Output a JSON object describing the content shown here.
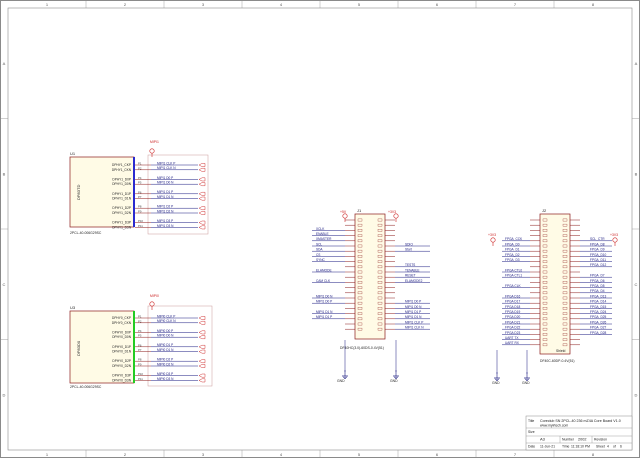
{
  "border": {
    "columns": [
      "1",
      "2",
      "3",
      "4",
      "5",
      "6",
      "7",
      "8"
    ],
    "rows": [
      "A",
      "B",
      "C",
      "D"
    ]
  },
  "u1": {
    "ref": "U1",
    "part": "DP83TD",
    "footprint": "2PCL-40-006G29SC",
    "pins_left": [
      "DPHY1_CKP",
      "DPHY1_CKN",
      "",
      "DPHY1_D0P",
      "DPHY1_D0N",
      "",
      "DPHY1_D1P",
      "DPHY1_D1N",
      "",
      "DPHY1_D2P",
      "DPHY1_D2N",
      "",
      "DPHY1_D3P",
      "DPHY1_D3N"
    ],
    "pin_nums": [
      "P1",
      "P2",
      "",
      "P4",
      "P5",
      "",
      "P6",
      "P7",
      "",
      "P8",
      "P9",
      "",
      "P10",
      "P11"
    ],
    "nets": [
      "MIPI1 CLK P",
      "MIPI1 CLK N",
      "",
      "MIPI1 D0 P",
      "MIPI1 D0 N",
      "",
      "MIPI1 D1 P",
      "MIPI1 D1 N",
      "",
      "MIPI1 D2 P",
      "MIPI1 D2 N",
      "",
      "MIPI1 D3 P",
      "MIPI1 D3 N"
    ],
    "header": "MIPI1",
    "accent": "#2a2ad0"
  },
  "u2": {
    "ref": "U3",
    "part": "DP83D0",
    "footprint": "2PCL-40-006G29SC",
    "pins_left": [
      "DPHY0_CKP",
      "DPHY0_CKN",
      "",
      "DPHY0_D0P",
      "DPHY0_D0N",
      "",
      "DPHY0_D1P",
      "DPHY0_D1N",
      "",
      "DPHY0_D2P",
      "DPHY0_D2N",
      "",
      "DPHY0_D3P",
      "DPHY0_D3N"
    ],
    "pin_nums": [
      "P1",
      "P2",
      "",
      "P4",
      "P5",
      "",
      "P6",
      "P7",
      "",
      "P8",
      "P9",
      "",
      "P10",
      "P11"
    ],
    "nets": [
      "MIPI0 CLK P",
      "MIPI0 CLK N",
      "",
      "MIPI0 D0 P",
      "MIPI0 D0 N",
      "",
      "MIPI0 D1 P",
      "MIPI0 D1 N",
      "",
      "MIPI0 D2 P",
      "MIPI0 D2 N",
      "",
      "MIPI0 D3 P",
      "MIPI0 D3 N"
    ],
    "header": "MIPI0",
    "accent": "#22cc22"
  },
  "j1": {
    "ref": "J1",
    "power_top_left": "+5V",
    "power_top_right": "+3V3",
    "left_nets": [
      "XCLK",
      "ENABLE",
      "XMASTER",
      "SCL",
      "SDA",
      "CS",
      "SYNC",
      "",
      "ELAMODE",
      "",
      "CAM CLK",
      "",
      "",
      "MIPI1 D0 N",
      "MIPI1 D0 P",
      "",
      "MIPI1 D1 N",
      "MIPI1 D1 P"
    ],
    "right_nets": [
      "",
      "SDIO",
      "Start",
      "",
      "",
      "TESTS",
      "TENABLE",
      "RESET",
      "ELAMODE2",
      "",
      "",
      "",
      "MIPI1 D0 P",
      "MIPI1 D0 N",
      "MIPI1 D1 P",
      "MIPI1 D1 N",
      "MIPI1 CLK P",
      "MIPI1 CLK N"
    ],
    "footprint": "DF40HC(3.0)-60DS-0.4V(51)",
    "gnd_left": "GND",
    "gnd_right": "GND"
  },
  "j2": {
    "ref": "J2",
    "power_left": "+3V3",
    "power_right": "+3V3",
    "left_nets": [
      "FPGA_CCK",
      "FPGA_D0",
      "FPGA_D1",
      "FPGA_D2",
      "FPGA_D3",
      "",
      "FPGA CTL0",
      "FPGA CTL1",
      "",
      "FPGA CLK",
      "",
      "FPGA D16",
      "FPGA D17",
      "FPGA D18",
      "FPGA D19",
      "FPGA D20",
      "FPGA D21",
      "FPGA D22",
      "FPGA D23",
      "UART TX",
      "UART RX"
    ],
    "right_nets": [
      "SCL_CTR",
      "FPGA_D8",
      "FPGA_D9",
      "FPGA_D10",
      "FPGA_D11",
      "FPGA_D12",
      "",
      "FPGA_D7",
      "FPGA_D6",
      "FPGA_D5",
      "FPGA_D4",
      "FPGA_D13",
      "FPGA_D14",
      "FPGA_D15",
      "FPGA_D24",
      "FPGA_D25",
      "FPGA_D26",
      "FPGA_D27",
      "FPGA_D28"
    ],
    "footprint": "DF40C-60DP-0.4V(51)",
    "shield": "Shield",
    "gnd_left": "GND",
    "gnd_right": "GND"
  },
  "title_block": {
    "title_label": "Title",
    "title": "Coreclub SN 2PCL-40 236 mZ4A Core Board V1.0",
    "url": "www.myirtech.com",
    "size_label": "Size",
    "size": "A3",
    "number_label": "Number",
    "number": "2002",
    "revision_label": "Revision",
    "date_label": "Date",
    "date": "11-Jun-21",
    "time_label": "Time",
    "time": "11:18:10 PM",
    "sheet_label": "Sheet",
    "sheet": "4",
    "of_label": "of",
    "of": "6"
  },
  "colors": {
    "border": "#8a8a8a",
    "wire": "#1a1a80",
    "power": "#cc2222",
    "component": "#8b1a1a",
    "text": "#222222"
  }
}
